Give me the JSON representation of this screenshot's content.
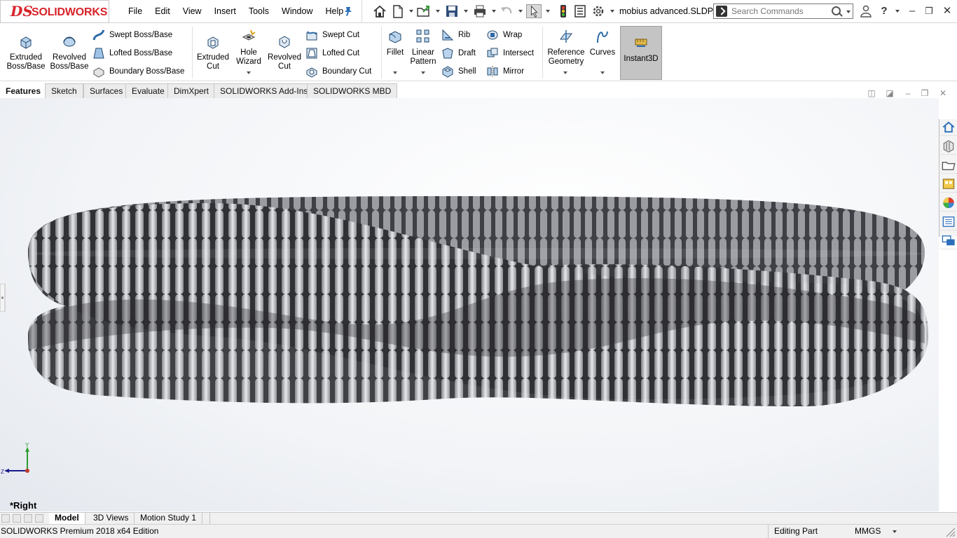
{
  "app": {
    "logo_ds": "DS",
    "logo_text": "SOLIDWORKS"
  },
  "menu": [
    "File",
    "Edit",
    "View",
    "Insert",
    "Tools",
    "Window",
    "Help"
  ],
  "document": {
    "title": "mobius advanced.SLDP..."
  },
  "search": {
    "placeholder": "Search Commands"
  },
  "ribbon": {
    "extruded_boss": "Extruded\nBoss/Base",
    "revolved_boss": "Revolved\nBoss/Base",
    "swept_boss": "Swept Boss/Base",
    "lofted_boss": "Lofted Boss/Base",
    "boundary_boss": "Boundary Boss/Base",
    "extruded_cut": "Extruded\nCut",
    "hole_wizard": "Hole\nWizard",
    "revolved_cut": "Revolved\nCut",
    "swept_cut": "Swept Cut",
    "lofted_cut": "Lofted Cut",
    "boundary_cut": "Boundary Cut",
    "fillet": "Fillet",
    "linear_pattern": "Linear\nPattern",
    "rib": "Rib",
    "draft": "Draft",
    "shell": "Shell",
    "wrap": "Wrap",
    "intersect": "Intersect",
    "mirror": "Mirror",
    "reference_geometry": "Reference\nGeometry",
    "curves": "Curves",
    "instant3d": "Instant3D"
  },
  "command_tabs": [
    "Features",
    "Sketch",
    "Surfaces",
    "Evaluate",
    "DimXpert",
    "SOLIDWORKS Add-Ins",
    "SOLIDWORKS MBD"
  ],
  "triad": {
    "y": "Y",
    "z": "Z"
  },
  "view_name": "*Right",
  "model_tabs": [
    "Model",
    "3D Views",
    "Motion Study 1"
  ],
  "status": {
    "edition": "SOLIDWORKS Premium 2018 x64 Edition",
    "mode": "Editing Part",
    "units": "MMGS"
  },
  "colors": {
    "brand": "#d8232a",
    "accent": "#1f6fb5",
    "active_tool_bg": "#c4c4c4"
  }
}
